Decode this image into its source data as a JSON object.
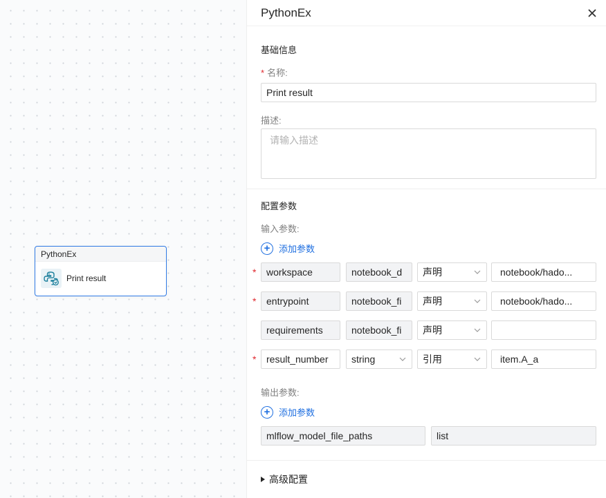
{
  "canvas": {
    "node": {
      "header": "PythonEx",
      "label": "Print result",
      "icon": "python-icon"
    }
  },
  "panel": {
    "title": "PythonEx",
    "basic_section": "基础信息",
    "name_label": "名称:",
    "name_value": "Print result",
    "desc_label": "描述:",
    "desc_placeholder": "请输入描述",
    "config_section": "配置参数",
    "input_params_label": "输入参数:",
    "add_param_label": "添加参数",
    "input_rows": [
      {
        "required": true,
        "name": "workspace",
        "type": "notebook_d",
        "type_is_select": false,
        "mode": "声明",
        "value": "notebook/hado..."
      },
      {
        "required": true,
        "name": "entrypoint",
        "type": "notebook_fi",
        "type_is_select": false,
        "mode": "声明",
        "value": "notebook/hado..."
      },
      {
        "required": false,
        "name": "requirements",
        "type": "notebook_fi",
        "type_is_select": false,
        "mode": "声明",
        "value": ""
      },
      {
        "required": true,
        "name": "result_number",
        "type": "string",
        "type_is_select": true,
        "mode": "引用",
        "value": "item.A_a"
      }
    ],
    "output_params_label": "输出参数:",
    "output_add_label": "添加参数",
    "output_row": {
      "name": "mlflow_model_file_paths",
      "type": "list"
    },
    "advanced_label": "高级配置",
    "required_mark": "*"
  },
  "colors": {
    "accent": "#2f7ae5",
    "link": "#1f6fe0",
    "required": "#e0282e"
  }
}
